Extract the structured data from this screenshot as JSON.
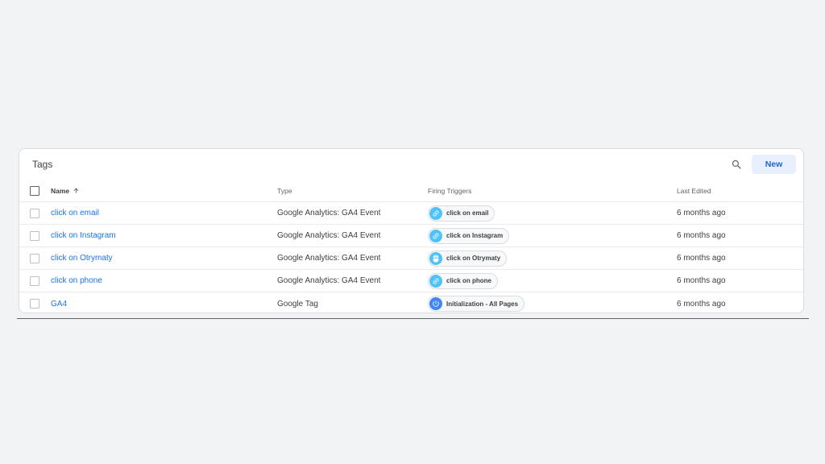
{
  "card": {
    "title": "Tags",
    "new_label": "New"
  },
  "columns": {
    "name": "Name",
    "type": "Type",
    "triggers": "Firing Triggers",
    "edited": "Last Edited"
  },
  "rows": [
    {
      "name": "click on email",
      "type": "Google Analytics: GA4 Event",
      "trigger": "click on email",
      "trigger_icon": "link-icon",
      "edited": "6 months ago"
    },
    {
      "name": "click on Instagram",
      "type": "Google Analytics: GA4 Event",
      "trigger": "click on Instagram",
      "trigger_icon": "link-icon",
      "edited": "6 months ago"
    },
    {
      "name": "click on Otrymaty",
      "type": "Google Analytics: GA4 Event",
      "trigger": "click on Otrymaty",
      "trigger_icon": "mouse-icon",
      "edited": "6 months ago"
    },
    {
      "name": "click on phone",
      "type": "Google Analytics: GA4 Event",
      "trigger": "click on phone",
      "trigger_icon": "link-icon",
      "edited": "6 months ago"
    },
    {
      "name": "GA4",
      "type": "Google Tag",
      "trigger": "Initialization - All Pages",
      "trigger_icon": "power-icon",
      "edited": "6 months ago"
    }
  ],
  "colors": {
    "link": "#1a73e8",
    "new_button_bg": "#e8f0fe",
    "trigger_click": "#4fc3f7",
    "trigger_init": "#4285f4"
  }
}
